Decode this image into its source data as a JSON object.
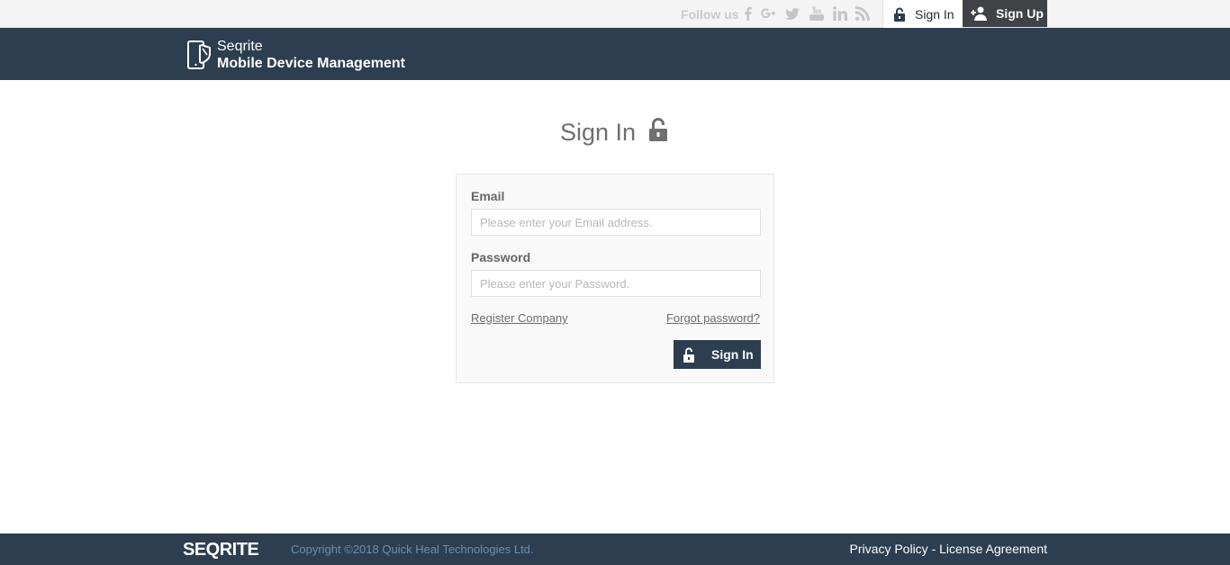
{
  "topbar": {
    "follow_label": "Follow us",
    "social": [
      {
        "icon": "facebook-icon",
        "glyph": "f"
      },
      {
        "icon": "google-plus-icon",
        "glyph": "g+"
      },
      {
        "icon": "twitter-icon",
        "glyph": "t"
      },
      {
        "icon": "youtube-icon",
        "glyph": "yt"
      },
      {
        "icon": "linkedin-icon",
        "glyph": "in"
      },
      {
        "icon": "rss-icon",
        "glyph": "rss"
      }
    ],
    "signin_label": "Sign In",
    "signup_label": "Sign Up"
  },
  "header": {
    "brand": "Seqrite",
    "product": "Mobile Device Management"
  },
  "main": {
    "title": "Sign In",
    "form": {
      "email_label": "Email",
      "email_placeholder": "Please enter your Email address.",
      "email_value": "",
      "password_label": "Password",
      "password_placeholder": "Please enter your Password.",
      "password_value": "",
      "register_link": "Register Company",
      "forgot_link": "Forgot password?",
      "submit_label": "Sign In"
    }
  },
  "footer": {
    "logo": "SEQRITE",
    "copyright": "Copyright ©2018 Quick Heal Technologies Ltd.",
    "privacy": "Privacy Policy",
    "separator": " - ",
    "license": "License Agreement"
  },
  "colors": {
    "header_bg": "#2c3e50",
    "signup_bg": "#3f4247",
    "topbar_bg": "#f4f4f4"
  }
}
